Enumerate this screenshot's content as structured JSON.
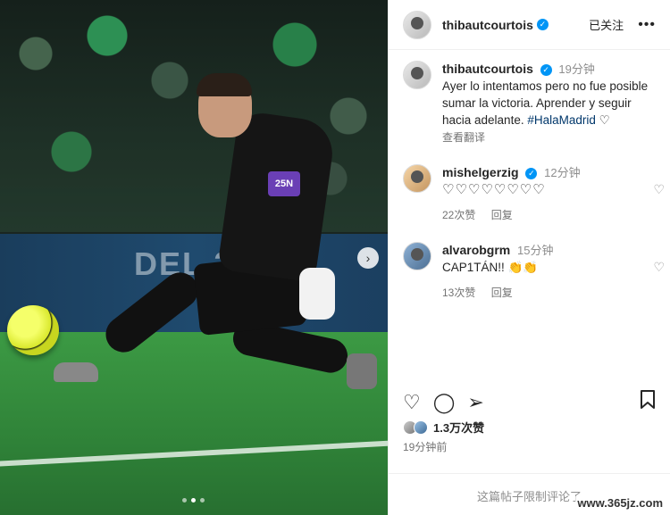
{
  "media": {
    "ad_text": "DEL 2",
    "armband_text": "25N",
    "carousel_dots": 3,
    "carousel_active_index": 1
  },
  "header": {
    "username": "thibautcourtois",
    "follow_label": "已关注",
    "more_label": "•••"
  },
  "caption": {
    "username": "thibautcourtois",
    "time": "19分钟",
    "text": "Ayer lo intentamos pero no fue posible sumar la victoria. Aprender y seguir hacia adelante.",
    "hashtag": "#HalaMadrid",
    "heart": "♡",
    "translate_label": "查看翻译"
  },
  "comments": [
    {
      "username": "mishelgerzig",
      "time": "12分钟",
      "text": "♡♡♡♡♡♡♡♡",
      "likes": "22次赞",
      "reply_label": "回复"
    },
    {
      "username": "alvarobgrm",
      "time": "15分钟",
      "text": "CAP1TÁN!! 👏👏",
      "likes": "13次赞",
      "reply_label": "回复"
    }
  ],
  "actions": {
    "likes": "1.3万次赞",
    "post_time": "19分钟前",
    "comments_off": "这篇帖子限制评论了"
  },
  "watermark": "www.365jz.com"
}
